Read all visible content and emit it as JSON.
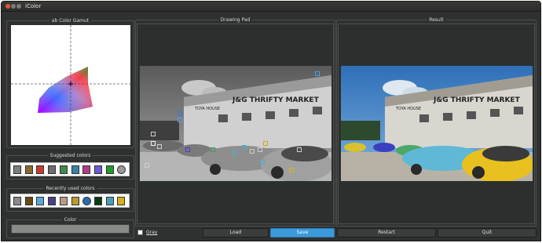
{
  "window": {
    "title": "iColor"
  },
  "gamut": {
    "title": "ab Color Gamut"
  },
  "suggested": {
    "title": "Suggested colors",
    "colors": [
      "#7d7d7d",
      "#8a6a2a",
      "#cc3a2e",
      "#6e6e6e",
      "#3f8a4e",
      "#3c7fa6",
      "#b43b8c",
      "#6b5bd6",
      "#1e9b2a",
      "#9a9a9a"
    ]
  },
  "recent": {
    "title": "Recently used colors",
    "colors": [
      "#8a8a8a",
      "#6a4a10",
      "#5ba6dd",
      "#4a3f8a",
      "#b89a86",
      "#b89a2e",
      "#2e6ab0",
      "#0a3a12",
      "#4a9fb8",
      "#d6ae1e"
    ]
  },
  "color_panel": {
    "title": "Color",
    "value": "#888a88"
  },
  "drawing_pad": {
    "title": "Drawing Pad"
  },
  "result": {
    "title": "Result"
  },
  "photo_sign": {
    "line1": "J&G THRIFTY MARKET",
    "line2": "TOYA HOUSE"
  },
  "controls": {
    "gray_label": "Gray",
    "load_label": "Load",
    "save_label": "Save",
    "restart_label": "Restart",
    "quit_label": "Quit"
  }
}
